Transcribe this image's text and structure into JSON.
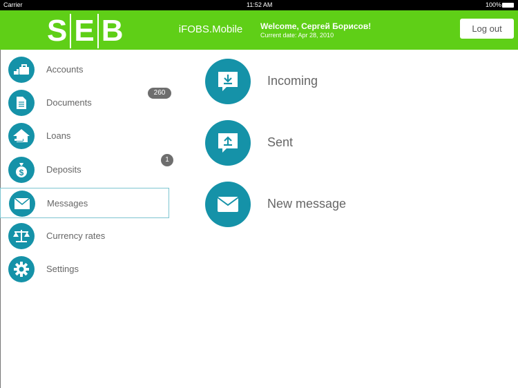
{
  "status_bar": {
    "carrier": "Carrier",
    "time": "11:52 AM",
    "battery": "100%"
  },
  "header": {
    "logo": "SEB",
    "logo_letters": [
      "S",
      "E",
      "B"
    ],
    "app_name": "iFOBS.Mobile",
    "welcome": "Welcome, Сергей Борисов!",
    "current_date": "Current date: Apr 28, 2010",
    "logout": "Log out"
  },
  "colors": {
    "green": "#5fcf17",
    "teal": "#1592a8"
  },
  "sidebar": {
    "items": [
      {
        "label": "Accounts",
        "icon": "briefcase-icon"
      },
      {
        "label": "Documents",
        "icon": "document-icon",
        "badge": "260"
      },
      {
        "label": "Loans",
        "icon": "house-car-icon"
      },
      {
        "label": "Deposits",
        "icon": "money-bag-icon",
        "badge": "1"
      },
      {
        "label": "Messages",
        "icon": "envelope-icon",
        "selected": true
      },
      {
        "label": "Currency rates",
        "icon": "scales-icon"
      },
      {
        "label": "Settings",
        "icon": "gear-icon"
      }
    ]
  },
  "main": {
    "actions": [
      {
        "label": "Incoming",
        "icon": "inbox-download-icon"
      },
      {
        "label": "Sent",
        "icon": "outbox-upload-icon"
      },
      {
        "label": "New message",
        "icon": "envelope-icon"
      }
    ]
  }
}
